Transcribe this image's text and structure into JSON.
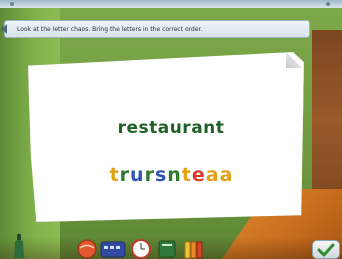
{
  "instruction": {
    "text": "Look at the letter chaos. Bring the letters in the correct order.",
    "icon": "speaker-icon"
  },
  "game": {
    "target_word": "restaurant",
    "scrambled_letters": [
      {
        "char": "t",
        "color": "#e3a117"
      },
      {
        "char": "r",
        "color": "#2e7a2e"
      },
      {
        "char": "u",
        "color": "#2f55b4"
      },
      {
        "char": "r",
        "color": "#2e7a2e"
      },
      {
        "char": "s",
        "color": "#2f55b4"
      },
      {
        "char": "n",
        "color": "#2e7a2e"
      },
      {
        "char": "t",
        "color": "#e3a117"
      },
      {
        "char": "e",
        "color": "#d63b2a"
      },
      {
        "char": "a",
        "color": "#e3a117"
      },
      {
        "char": "a",
        "color": "#e3a117"
      }
    ]
  },
  "toolbar": {
    "items": [
      "bottle-icon",
      "globe-icon",
      "keyboard-icon",
      "clock-icon",
      "book-icon",
      "folder-icon"
    ],
    "confirm": "checkmark-icon"
  },
  "colors": {
    "target_word": "#22602a",
    "background": "#6f9a3e",
    "accent_check": "#2e8a2e"
  }
}
